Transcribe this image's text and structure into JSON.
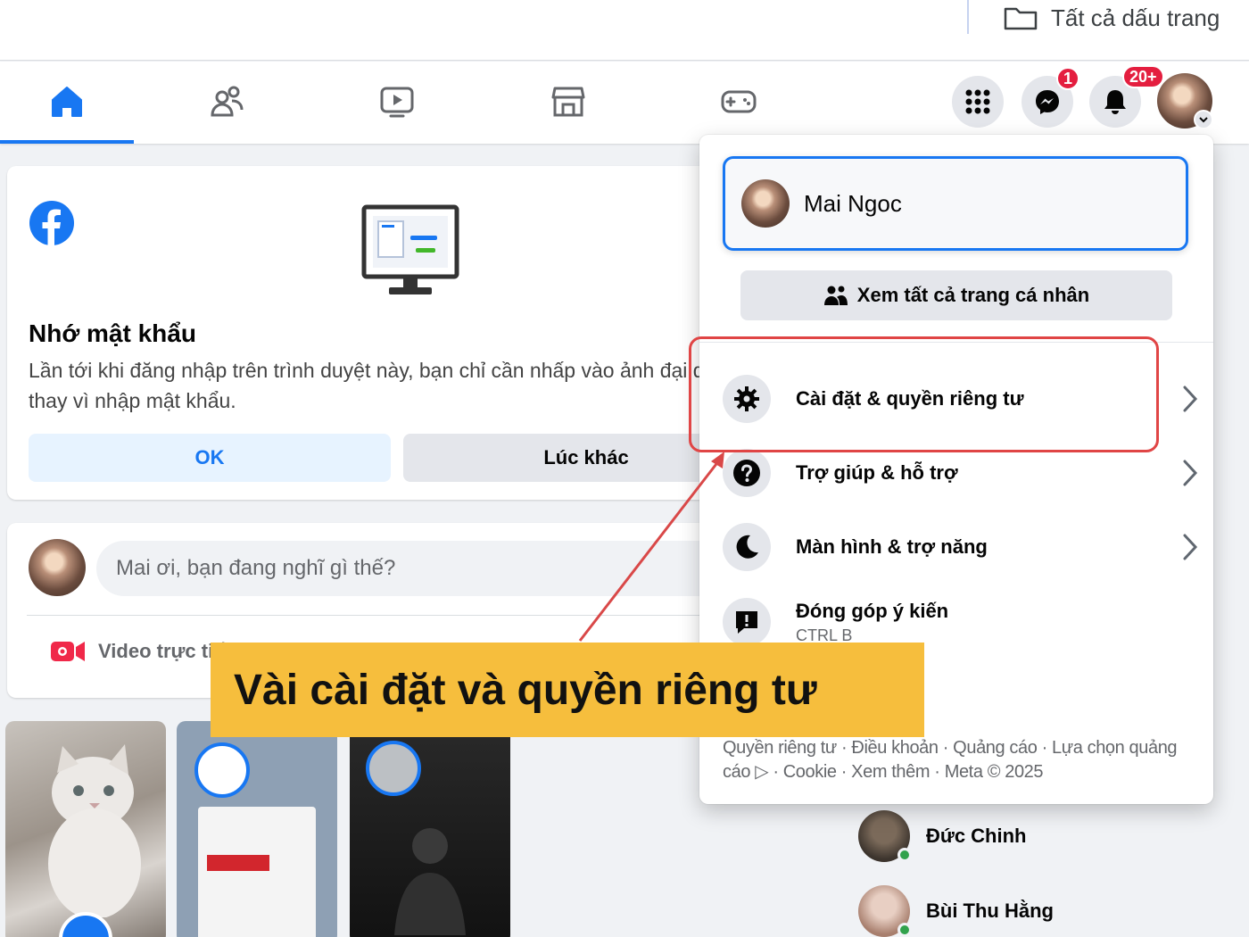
{
  "browser": {
    "bookmarks_folder_label": "Tất cả dấu trang",
    "folder_icon": "folder-icon"
  },
  "nav": {
    "tabs": [
      {
        "name": "home",
        "icon": "home-icon",
        "active": true
      },
      {
        "name": "friends",
        "icon": "friends-icon",
        "active": false
      },
      {
        "name": "video",
        "icon": "video-icon",
        "active": false
      },
      {
        "name": "marketplace",
        "icon": "marketplace-icon",
        "active": false
      },
      {
        "name": "gaming",
        "icon": "gaming-icon",
        "active": false
      }
    ],
    "messenger_badge": "1",
    "notifications_badge": "20+",
    "accent_color": "#1877f2",
    "badge_color": "#e41e3f"
  },
  "remember_password": {
    "title": "Nhớ mật khẩu",
    "description": "Lần tới khi đăng nhập trên trình duyệt này, bạn chỉ cần nhấp vào ảnh đại diện thay vì nhập mật khẩu.",
    "ok_label": "OK",
    "later_label": "Lúc khác"
  },
  "composer": {
    "placeholder": "Mai ơi, bạn đang nghĩ gì thế?",
    "live_video_label": "Video trực tiếp"
  },
  "account_menu": {
    "profile_name": "Mai Ngoc",
    "see_all_profiles": "Xem tất cả trang cá nhân",
    "items": [
      {
        "label": "Cài đặt & quyền riêng tư",
        "icon": "gear-icon",
        "has_chevron": true
      },
      {
        "label": "Trợ giúp & hỗ trợ",
        "icon": "help-icon",
        "has_chevron": true
      },
      {
        "label": "Màn hình & trợ năng",
        "icon": "moon-icon",
        "has_chevron": true
      },
      {
        "label": "Đóng góp ý kiến",
        "sub": "CTRL B",
        "icon": "feedback-icon",
        "has_chevron": false
      }
    ],
    "footer": "Quyền riêng tư · Điều khoản · Quảng cáo · Lựa chọn quảng cáo ▷ · Cookie · Xem thêm · Meta © 2025"
  },
  "contacts": [
    {
      "name": "Đức Chinh",
      "online": true
    },
    {
      "name": "Bùi Thu Hằng",
      "online": true
    }
  ],
  "annotation": {
    "banner_text": "Vài cài đặt và quyền riêng tư",
    "banner_color": "#f6be3d",
    "highlight_color": "#e04545"
  }
}
